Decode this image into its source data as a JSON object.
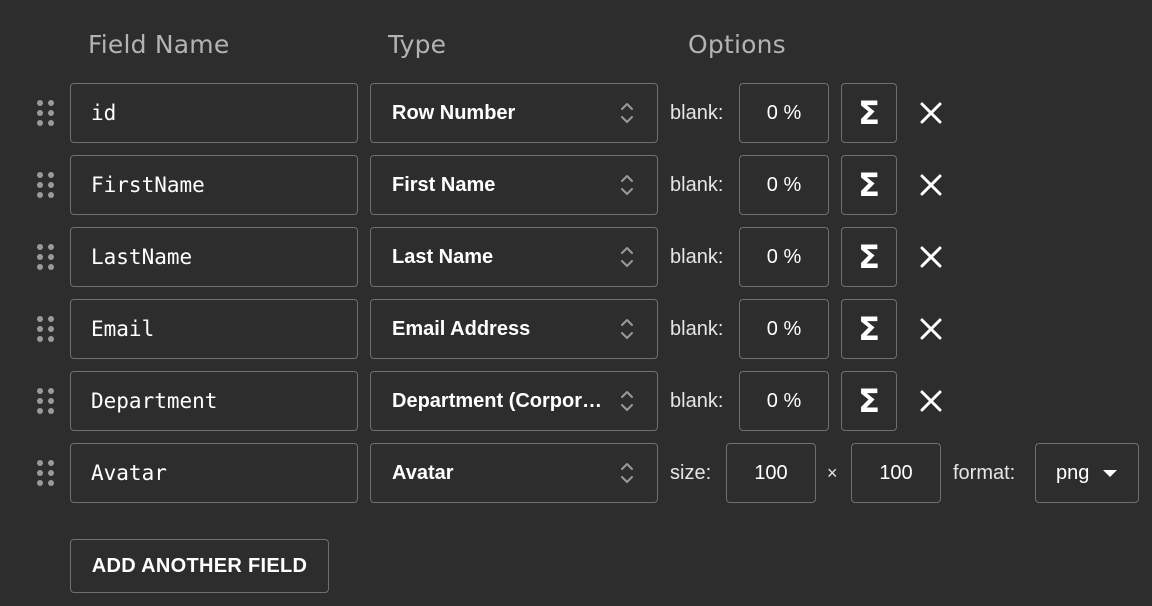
{
  "headers": {
    "field_name": "Field Name",
    "type": "Type",
    "options": "Options"
  },
  "icons": {
    "grip": "drag-handle-icon",
    "type_select": "up-down-chevron-icon",
    "formula": "sigma-icon",
    "remove": "close-icon",
    "dropdown": "caret-down-icon"
  },
  "fields": [
    {
      "name": "id",
      "type": "Row Number",
      "blank_label": "blank:",
      "blank_value": "0 %",
      "formula_label": "Σ"
    },
    {
      "name": "FirstName",
      "type": "First Name",
      "blank_label": "blank:",
      "blank_value": "0 %",
      "formula_label": "Σ"
    },
    {
      "name": "LastName",
      "type": "Last Name",
      "blank_label": "blank:",
      "blank_value": "0 %",
      "formula_label": "Σ"
    },
    {
      "name": "Email",
      "type": "Email Address",
      "blank_label": "blank:",
      "blank_value": "0 %",
      "formula_label": "Σ"
    },
    {
      "name": "Department",
      "type": "Department (Corpor…",
      "blank_label": "blank:",
      "blank_value": "0 %",
      "formula_label": "Σ"
    },
    {
      "name": "Avatar",
      "type": "Avatar",
      "size_label": "size:",
      "width": "100",
      "times": "×",
      "height": "100",
      "format_label": "format:",
      "format": "png"
    }
  ],
  "add_button": "ADD ANOTHER FIELD",
  "colors": {
    "background": "#2d2d2d",
    "border": "#6f6f6f",
    "header_text": "#b3b3b3",
    "text": "#ffffff",
    "icon": "#9a9a9a"
  }
}
